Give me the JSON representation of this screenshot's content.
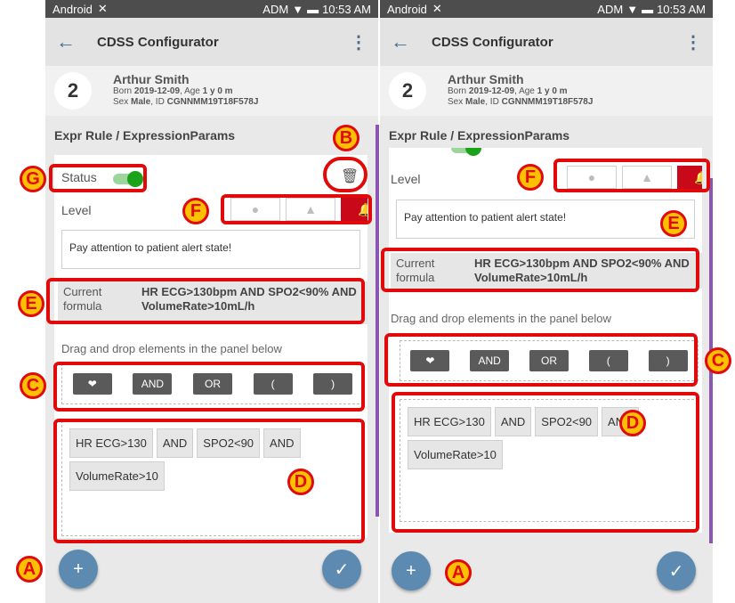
{
  "status_bar": {
    "carrier": "Android",
    "network": "ADM",
    "time": "10:53 AM"
  },
  "app_bar": {
    "title": "CDSS Configurator"
  },
  "patient": {
    "bed": "2",
    "name": "Arthur Smith",
    "born_label": "Born ",
    "born": "2019-12-09",
    "age_label": ", Age ",
    "age": "1 y 0 m",
    "sex_label": "Sex ",
    "sex": "Male",
    "id_label": ", ID ",
    "id": "CGNNMM19T18F578J"
  },
  "section_title": "Expr Rule / ExpressionParams",
  "status_label": "Status",
  "level_label": "Level",
  "message": "Pay attention to patient alert state!",
  "formula_label_1": "Current",
  "formula_label_2": "formula",
  "formula_line_1": "HR ECG>130bpm AND SPO2<90% AND",
  "formula_line_2": "VolumeRate>10mL/h",
  "hint": "Drag and drop elements in the panel below",
  "palette": {
    "and": "AND",
    "or": "OR",
    "open": "(",
    "close": ")"
  },
  "chips": [
    "HR ECG>130",
    "AND",
    "SPO2<90",
    "AND",
    "VolumeRate>10"
  ],
  "fab_add": "+",
  "fab_confirm": "✓",
  "callouts": {
    "a": "A",
    "b": "B",
    "c": "C",
    "d": "D",
    "e": "E",
    "f": "F",
    "g": "G"
  },
  "colors": {
    "accent": "#5d8ab0",
    "alert_active": "#c9091a",
    "toggle_on": "#1aa31a",
    "callout": "#e10a0a",
    "marker": "#ffc000"
  }
}
